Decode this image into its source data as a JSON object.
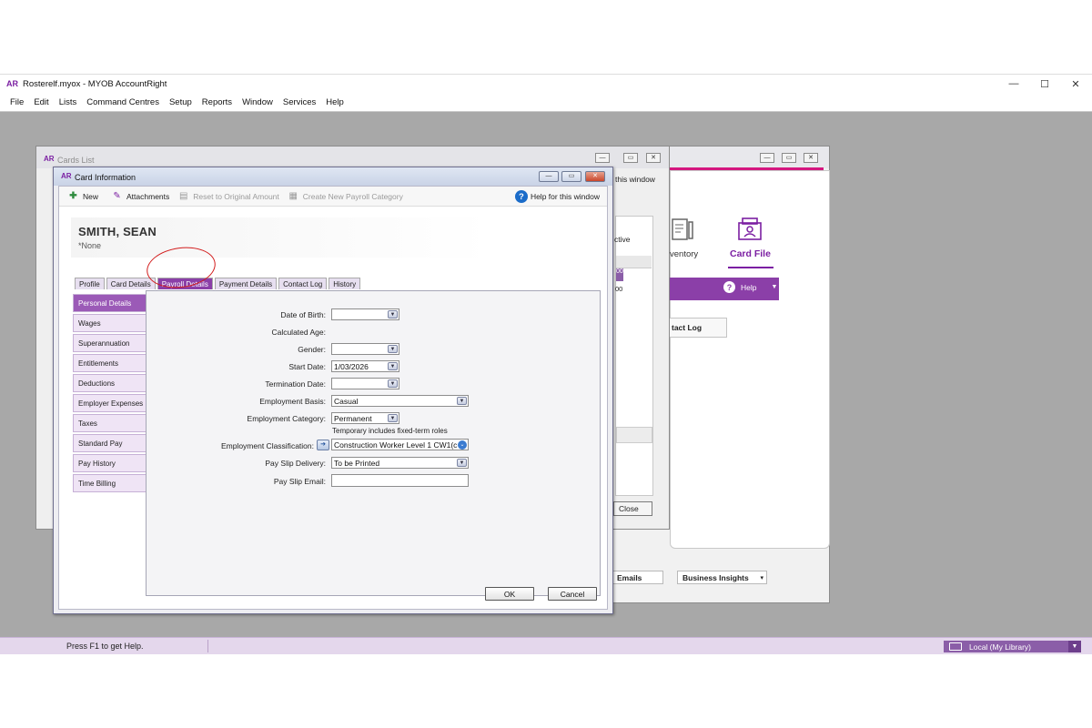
{
  "app": {
    "logo": "AR",
    "title": "Rosterelf.myox - MYOB AccountRight",
    "window_controls": [
      "—",
      "☐",
      "✕"
    ]
  },
  "menu": [
    "File",
    "Edit",
    "Lists",
    "Command Centres",
    "Setup",
    "Reports",
    "Window",
    "Services",
    "Help"
  ],
  "statusbar": {
    "help_text": "Press F1 to get Help.",
    "library": "Local (My Library)"
  },
  "command_centre": {
    "inventory_label": "ventory",
    "card_file_label": "Card File",
    "help_label": "Help",
    "contact_log_button": "tact Log",
    "emails_button": "Emails",
    "business_insights_button": "Business Insights"
  },
  "cards_list": {
    "logo": "AR",
    "title": "Cards List",
    "help_snippet": "this window",
    "active_label": "ctive",
    "row_values": [
      "00",
      "00"
    ],
    "close_button": "Close"
  },
  "card_info": {
    "logo": "AR",
    "title": "Card Information",
    "toolbar": {
      "new": "New",
      "attachments": "Attachments",
      "reset": "Reset to Original Amount",
      "create_payroll": "Create New Payroll Category",
      "help": "Help for this window"
    },
    "name": "SMITH, SEAN",
    "subname": "*None",
    "tabs": [
      "Profile",
      "Card Details",
      "Payroll Details",
      "Payment Details",
      "Contact Log",
      "History"
    ],
    "active_tab": "Payroll Details",
    "sidenav": [
      "Personal Details",
      "Wages",
      "Superannuation",
      "Entitlements",
      "Deductions",
      "Employer Expenses",
      "Taxes",
      "Standard Pay",
      "Pay History",
      "Time Billing"
    ],
    "active_sidenav": "Personal Details",
    "form": {
      "dob_label": "Date of Birth:",
      "dob_value": "",
      "age_label": "Calculated Age:",
      "gender_label": "Gender:",
      "gender_value": "",
      "start_label": "Start Date:",
      "start_value": "1/03/2026",
      "term_label": "Termination Date:",
      "term_value": "",
      "basis_label": "Employment Basis:",
      "basis_value": "Casual",
      "category_label": "Employment Category:",
      "category_value": "Permanent",
      "category_note": "Temporary includes fixed-term roles",
      "classification_label": "Employment Classification:",
      "classification_value": "Construction Worker Level 1 CW1(c",
      "payslip_delivery_label": "Pay Slip Delivery:",
      "payslip_delivery_value": "To be Printed",
      "payslip_email_label": "Pay Slip Email:",
      "payslip_email_value": ""
    },
    "ok_button": "OK",
    "cancel_button": "Cancel"
  },
  "colors": {
    "accent_purple": "#8b3fa8",
    "pink": "#d4177f",
    "annotation_red": "#d21c1c",
    "help_blue": "#1b6cc9"
  }
}
